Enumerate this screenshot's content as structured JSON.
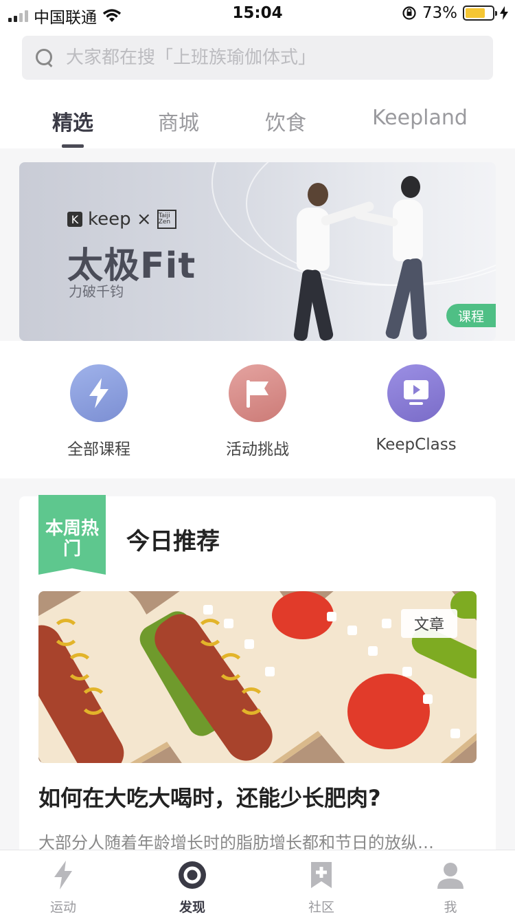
{
  "status_bar": {
    "carrier": "中国联通",
    "time": "15:04",
    "battery": "73%",
    "battery_level": 0.73
  },
  "search": {
    "placeholder": "大家都在搜「上班族瑜伽体式」"
  },
  "tabs": [
    {
      "label": "精选",
      "active": true
    },
    {
      "label": "商城",
      "active": false
    },
    {
      "label": "饮食",
      "active": false
    },
    {
      "label": "Keepland",
      "active": false
    }
  ],
  "banner": {
    "brand": "keep ×",
    "brand_k": "K",
    "partner_logo": "Taiji Zen",
    "title": "太极Fit",
    "subtitle": "力破千钧",
    "badge": "课程"
  },
  "quick_links": [
    {
      "label": "全部课程",
      "icon": "lightning-icon",
      "color": "#8aa1dc"
    },
    {
      "label": "活动挑战",
      "icon": "flag-icon",
      "color": "#d78a86"
    },
    {
      "label": "KeepClass",
      "icon": "play-screen-icon",
      "color": "#8b7fd6"
    }
  ],
  "recommend": {
    "hot_badge": "本周热门",
    "heading": "今日推荐",
    "image_badge": "文章",
    "article_title": "如何在大吃大喝时，还能少长肥肉?",
    "article_excerpt": "大部分人随着年龄增长时的脂肪增长都和节日的放纵…"
  },
  "bottom_nav": [
    {
      "label": "运动",
      "icon": "lightning-icon",
      "active": false
    },
    {
      "label": "发现",
      "icon": "discover-ring-icon",
      "active": true
    },
    {
      "label": "社区",
      "icon": "bookmark-plus-icon",
      "active": false
    },
    {
      "label": "我",
      "icon": "person-icon",
      "active": false
    }
  ],
  "colors": {
    "accent_green": "#5ec78e",
    "active_text": "#3a3a45",
    "inactive_text": "#9a9a9e"
  }
}
